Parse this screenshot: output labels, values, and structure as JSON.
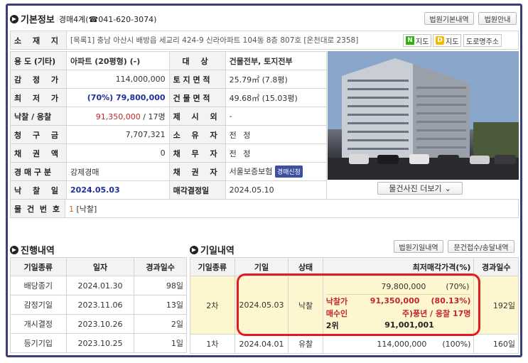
{
  "basic": {
    "section_title": "기본정보",
    "court_dept": "경매4계(☎041-620-3074)",
    "buttons": {
      "court_basic": "법원기본내역",
      "court_guide": "법원안내"
    },
    "address_label": "소 재 지",
    "address": "[목록1] 충남 아산시 배방읍 세교리 424-9 신라아파트 104동 8층 807호 [온천대로 2358]",
    "map_buttons": {
      "naver": "지도",
      "daum": "지도",
      "road": "도로명주소"
    },
    "rows": {
      "usage": {
        "label": "용 도 (기타)",
        "value": "아파트 (20평형) (-)"
      },
      "target": {
        "label": "대 상",
        "value": "건물전부, 토지전부"
      },
      "appraisal": {
        "label": "감 정 가",
        "value": "114,000,000"
      },
      "land_area": {
        "label": "토 지 면 적",
        "value": "25.79㎡ (7.8평)"
      },
      "min_price": {
        "label": "최 저 가",
        "value": "(70%) 79,800,000"
      },
      "building_area": {
        "label": "건 물 면 적",
        "value": "49.68㎡ (15.03평)"
      },
      "winning_bid": {
        "label": "낙찰 / 응찰",
        "value": "91,350,000",
        "bidders": " / 17명"
      },
      "excluded": {
        "label": "제 시 외",
        "value": "-"
      },
      "claim": {
        "label": "청 구 금",
        "value": "7,707,321"
      },
      "owner": {
        "label": "소 유 자",
        "value": "전 정"
      },
      "bond_amount": {
        "label": "채 권 액",
        "value": "0"
      },
      "debtor": {
        "label": "채 무 자",
        "value": "전 정"
      },
      "auction_type": {
        "label": "경 매 구 분",
        "value": "강제경매"
      },
      "creditor": {
        "label": "채 권 자",
        "value": "서울보증보험",
        "badge": "경매신청"
      },
      "bid_date": {
        "label": "낙 찰 일",
        "value": "2024.05.03"
      },
      "sale_decision": {
        "label": "매각결정일",
        "value": "2024.05.10"
      },
      "item_no": {
        "label": "물 건 번 호",
        "value": "1",
        "status": " [낙찰]"
      }
    },
    "photo_more": "물건사진 더보기"
  },
  "progress": {
    "section_title": "진행내역",
    "headers": [
      "기일종류",
      "일자",
      "경과일수"
    ],
    "rows": [
      {
        "type": "배당종기",
        "date": "2024.01.30",
        "days": "98일"
      },
      {
        "type": "감정기일",
        "date": "2023.11.06",
        "days": "13일"
      },
      {
        "type": "개시결정",
        "date": "2023.10.26",
        "days": "2일"
      },
      {
        "type": "등기기입",
        "date": "2023.10.25",
        "days": "1일"
      }
    ]
  },
  "schedule": {
    "section_title": "기일내역",
    "buttons": {
      "court_schedule": "법원기일내역",
      "doc_receipt": "문건접수/송달내역"
    },
    "headers": [
      "기일종류",
      "기일",
      "상태",
      "최저매각가격(%)",
      "경과일수"
    ],
    "round2": {
      "type": "2차",
      "date": "2024.05.03",
      "status": "낙찰",
      "min_price": "79,800,000",
      "min_pct": "(70%)",
      "bid_label": "낙찰가",
      "bid_price": "91,350,000",
      "bid_pct": "(80.13%)",
      "buyer_label": "매수인",
      "buyer_info": "주)풍년 / 응찰 17명",
      "second_label": "2위",
      "second_price": "91,001,001",
      "days": "192일"
    },
    "round1": {
      "type": "1차",
      "date": "2024.04.01",
      "status": "유찰",
      "min_price": "114,000,000",
      "min_pct": "(100%)",
      "days": "160일"
    }
  },
  "colors": {
    "frame": "#3a3f7a",
    "accent_blue": "#1e2f9a",
    "accent_red": "#c0262a",
    "highlight_ring": "#e01b24",
    "highlight_bg": "#fdf6cf"
  }
}
